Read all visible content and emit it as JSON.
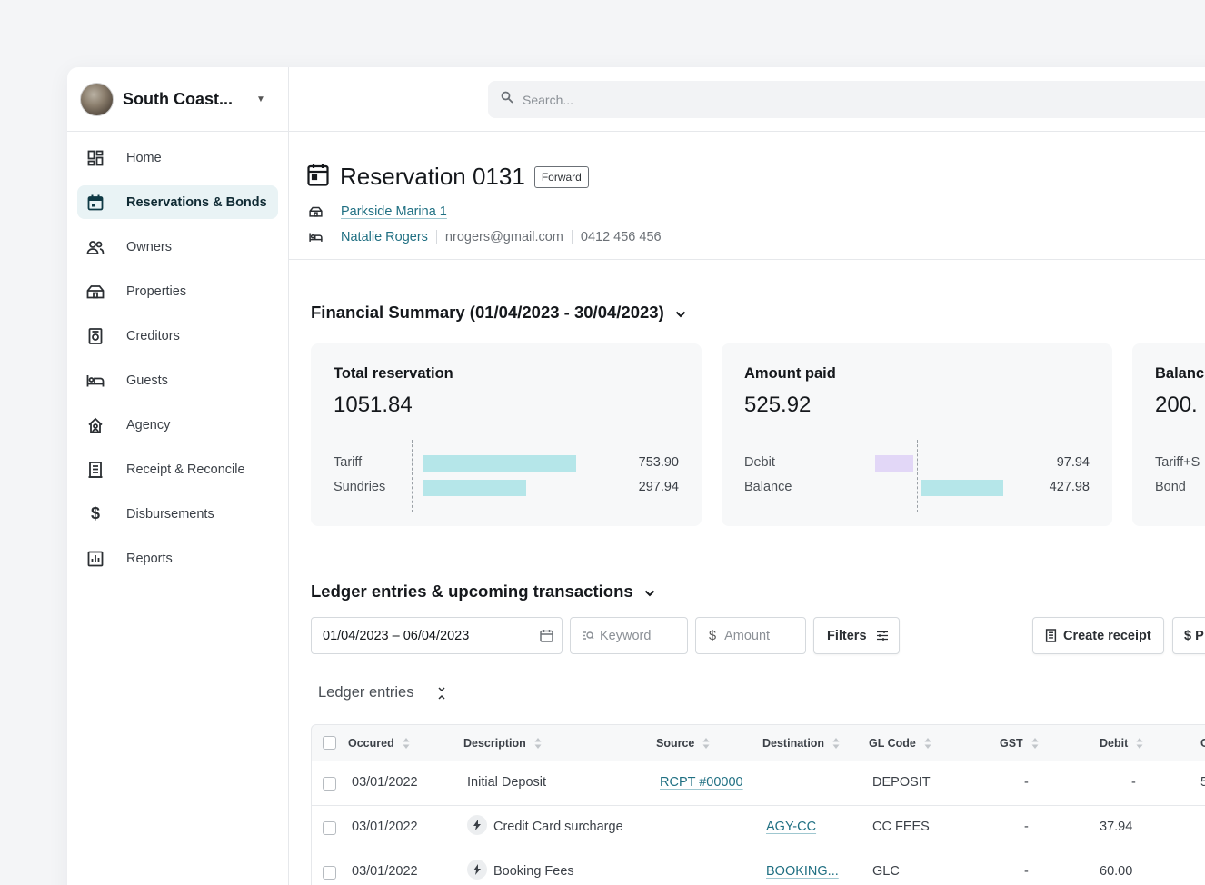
{
  "brand": {
    "name": "South Coast..."
  },
  "search": {
    "placeholder": "Search..."
  },
  "sidebar": {
    "items": [
      {
        "label": "Home",
        "icon": "dashboard-icon"
      },
      {
        "label": "Reservations & Bonds",
        "icon": "calendar-icon",
        "active": true
      },
      {
        "label": "Owners",
        "icon": "people-icon"
      },
      {
        "label": "Properties",
        "icon": "house-icon"
      },
      {
        "label": "Creditors",
        "icon": "document-icon"
      },
      {
        "label": "Guests",
        "icon": "bed-icon"
      },
      {
        "label": "Agency",
        "icon": "agency-icon"
      },
      {
        "label": "Receipt & Reconcile",
        "icon": "receipt-icon"
      },
      {
        "label": "Disbursements",
        "icon": "dollar-icon"
      },
      {
        "label": "Reports",
        "icon": "report-icon"
      }
    ]
  },
  "reservation": {
    "title": "Reservation 0131",
    "badge": "Forward",
    "property": "Parkside Marina 1",
    "guest_name": "Natalie Rogers",
    "guest_email": "nrogers@gmail.com",
    "guest_phone": "0412 456 456"
  },
  "financial_summary": {
    "title": "Financial Summary (01/04/2023 - 30/04/2023)",
    "cards": [
      {
        "label": "Total reservation",
        "value": "1051.84",
        "rows": [
          {
            "label": "Tariff",
            "value": "753.90"
          },
          {
            "label": "Sundries",
            "value": "297.94"
          }
        ]
      },
      {
        "label": "Amount paid",
        "value": "525.92",
        "rows": [
          {
            "label": "Debit",
            "value": "97.94"
          },
          {
            "label": "Balance",
            "value": "427.98"
          }
        ]
      },
      {
        "label": "Balanc",
        "value": "200.",
        "rows": [
          {
            "label": "Tariff+S",
            "value": ""
          },
          {
            "label": "Bond",
            "value": ""
          }
        ]
      }
    ],
    "colors": {
      "teal": "#b5e6e9",
      "lavender": "#e2d7f7"
    }
  },
  "ledger": {
    "title": "Ledger entries & upcoming transactions",
    "date_range": "01/04/2023 – 06/04/2023",
    "keyword_placeholder": "Keyword",
    "amount_placeholder": "Amount",
    "filters_label": "Filters",
    "create_receipt_label": "Create receipt",
    "partial_button_label": "$ P",
    "subheading": "Ledger entries",
    "columns": [
      "Occured",
      "Description",
      "Source",
      "Destination",
      "GL Code",
      "GST",
      "Debit",
      "C"
    ],
    "rows": [
      {
        "date": "03/01/2022",
        "description": "Initial Deposit",
        "bolt": false,
        "source": "RCPT #00000",
        "destination": "",
        "gl_code": "DEPOSIT",
        "gst": "-",
        "debit": "-",
        "credit": "5"
      },
      {
        "date": "03/01/2022",
        "description": "Credit Card surcharge",
        "bolt": true,
        "source": "",
        "destination": "AGY-CC",
        "gl_code": "CC FEES",
        "gst": "-",
        "debit": "37.94",
        "credit": ""
      },
      {
        "date": "03/01/2022",
        "description": "Booking Fees",
        "bolt": true,
        "source": "",
        "destination": "BOOKING...",
        "gl_code": "GLC",
        "gst": "-",
        "debit": "60.00",
        "credit": ""
      }
    ]
  }
}
